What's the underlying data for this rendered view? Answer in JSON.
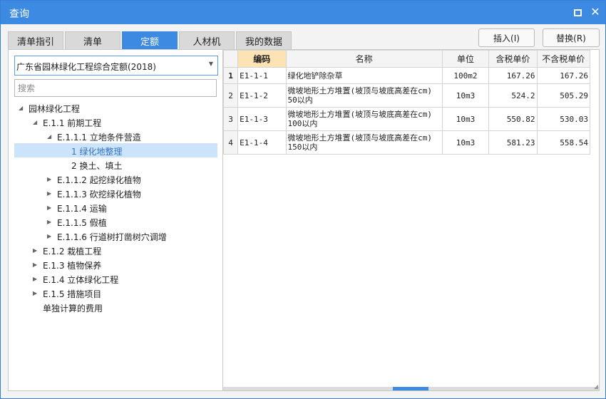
{
  "window": {
    "title": "查询"
  },
  "tabs": [
    "清单指引",
    "清单",
    "定额",
    "人材机",
    "我的数据"
  ],
  "buttons": {
    "insert": "插入(I)",
    "replace": "替换(R)"
  },
  "left": {
    "select_value": "广东省园林绿化工程综合定额(2018)",
    "search_placeholder": "搜索",
    "tree": [
      {
        "label": "园林绿化工程",
        "expanded": true
      },
      {
        "label": "E.1.1 前期工程",
        "expanded": true
      },
      {
        "label": "E.1.1.1 立地条件营造",
        "expanded": true
      },
      {
        "label": "1 绿化地整理",
        "selected": true
      },
      {
        "label": "2 换土、填土"
      },
      {
        "label": "E.1.1.2 起挖绿化植物",
        "expanded": false
      },
      {
        "label": "E.1.1.3 砍挖绿化植物",
        "expanded": false
      },
      {
        "label": "E.1.1.4 运输",
        "expanded": false
      },
      {
        "label": "E.1.1.5 假植",
        "expanded": false
      },
      {
        "label": "E.1.1.6 行道树打凿树穴调增",
        "expanded": false
      },
      {
        "label": "E.1.2 栽植工程",
        "expanded": false
      },
      {
        "label": "E.1.3 植物保养",
        "expanded": false
      },
      {
        "label": "E.1.4 立体绿化工程",
        "expanded": false
      },
      {
        "label": "E.1.5 措施项目",
        "expanded": false
      },
      {
        "label": "单独计算的费用"
      }
    ]
  },
  "table": {
    "headers": [
      "编码",
      "名称",
      "单位",
      "含税单价",
      "不含税单价"
    ],
    "rows": [
      {
        "no": "1",
        "code": "E1-1-1",
        "name": "绿化地铲除杂草",
        "unit": "100m2",
        "price_tax": "167.26",
        "price_notax": "167.26"
      },
      {
        "no": "2",
        "code": "E1-1-2",
        "name": "微坡地形土方堆置(坡顶与坡底高差在cm) 50以内",
        "unit": "10m3",
        "price_tax": "524.2",
        "price_notax": "505.29"
      },
      {
        "no": "3",
        "code": "E1-1-3",
        "name": "微坡地形土方堆置(坡顶与坡底高差在cm) 100以内",
        "unit": "10m3",
        "price_tax": "550.82",
        "price_notax": "530.03"
      },
      {
        "no": "4",
        "code": "E1-1-4",
        "name": "微坡地形土方堆置(坡顶与坡底高差在cm) 150以内",
        "unit": "10m3",
        "price_tax": "581.23",
        "price_notax": "558.54"
      }
    ]
  }
}
